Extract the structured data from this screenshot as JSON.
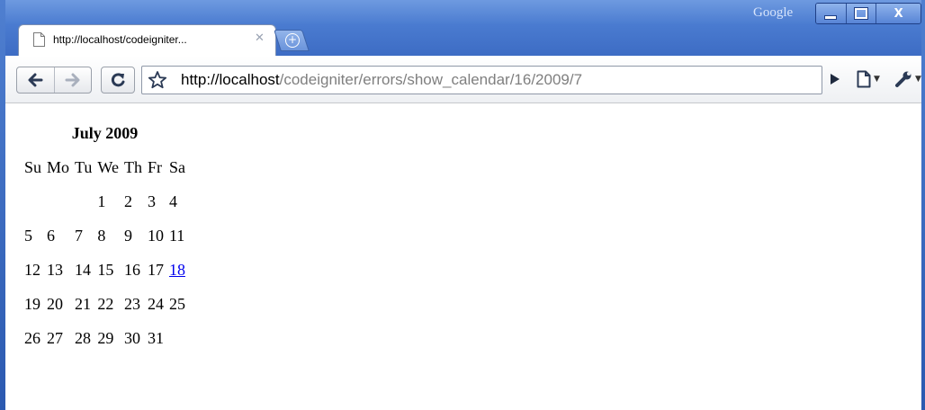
{
  "browser": {
    "brand_label": "Google",
    "tab": {
      "title": "http://localhost/codeigniter..."
    },
    "address_bar": {
      "url_host": "http://localhost",
      "url_path": "/codeigniter/errors/show_calendar/16/2009/7"
    }
  },
  "calendar": {
    "caption": "July 2009",
    "weekdays": [
      "Su",
      "Mo",
      "Tu",
      "We",
      "Th",
      "Fr",
      "Sa"
    ],
    "weeks": [
      [
        "",
        "",
        "",
        "1",
        "2",
        "3",
        "4"
      ],
      [
        "5",
        "6",
        "7",
        "8",
        "9",
        "10",
        "11"
      ],
      [
        "12",
        "13",
        "14",
        "15",
        "16",
        "17",
        "18"
      ],
      [
        "19",
        "20",
        "21",
        "22",
        "23",
        "24",
        "25"
      ],
      [
        "26",
        "27",
        "28",
        "29",
        "30",
        "31",
        ""
      ]
    ],
    "linked_day": "18",
    "link_color": "#0000ee"
  },
  "icons": {
    "back": "back-arrow-icon",
    "forward": "forward-arrow-icon",
    "reload": "reload-icon",
    "star": "star-icon",
    "go": "go-icon",
    "page": "page-icon",
    "wrench": "wrench-icon",
    "favicon": "page-favicon-icon",
    "new_tab": "new-tab-icon"
  },
  "colors": {
    "titlebar": "#4a7bd0",
    "toolbar": "#eef0f3"
  }
}
